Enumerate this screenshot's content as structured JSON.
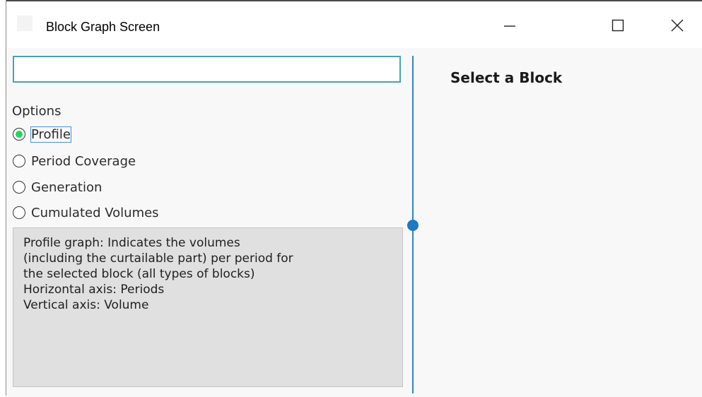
{
  "window": {
    "title": "Block Graph Screen",
    "minimize_icon": "minimize-icon",
    "maximize_icon": "maximize-icon",
    "close_icon": "close-icon"
  },
  "search": {
    "value": "",
    "placeholder": ""
  },
  "options": {
    "label": "Options",
    "items": [
      {
        "label": "Profile",
        "selected": true
      },
      {
        "label": "Period Coverage",
        "selected": false
      },
      {
        "label": "Generation",
        "selected": false
      },
      {
        "label": "Cumulated Volumes",
        "selected": false
      }
    ]
  },
  "description": {
    "lines": [
      "Profile graph: Indicates the volumes",
      "(including the curtailable part) per period for",
      "the selected block (all types of blocks)",
      "Horizontal axis: Periods",
      "Vertical axis: Volume"
    ]
  },
  "right_panel": {
    "heading": "Select a Block"
  },
  "colors": {
    "accent": "#47a5a9",
    "splitter": "#2e86c6",
    "radio_selected": "#1ed760"
  }
}
